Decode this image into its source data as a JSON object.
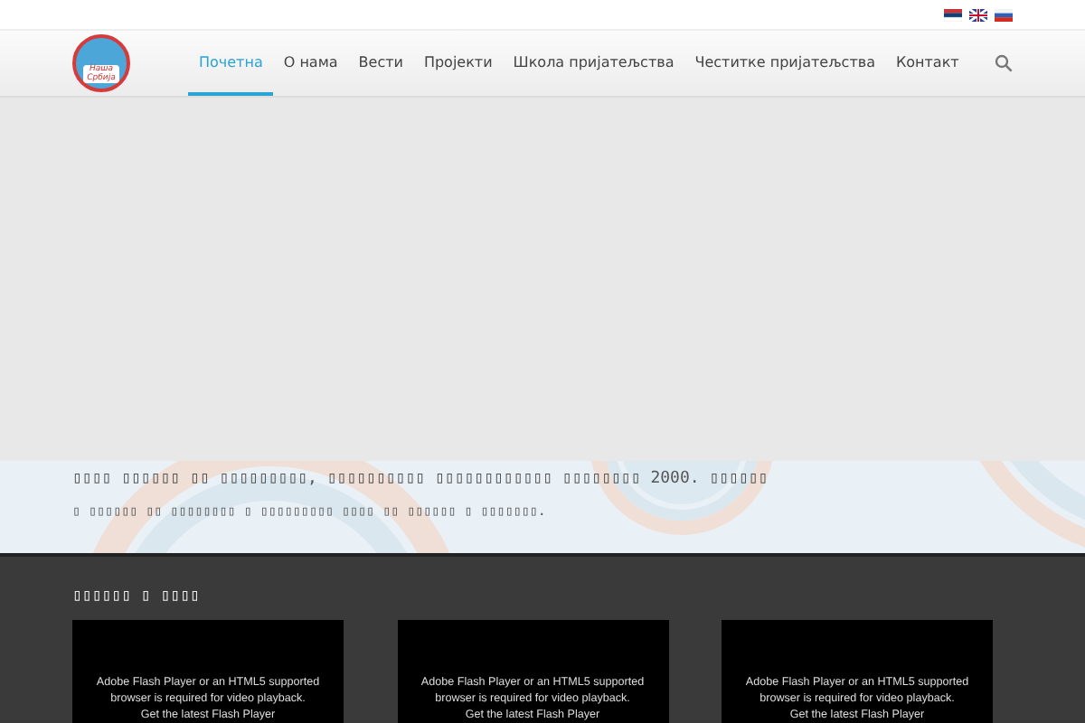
{
  "logo": {
    "text": "Наша Србија"
  },
  "nav": [
    {
      "label": "Почетна",
      "selected": true
    },
    {
      "label": "О нама",
      "selected": false
    },
    {
      "label": "Вести",
      "selected": false
    },
    {
      "label": "Пројекти",
      "selected": false
    },
    {
      "label": "Школа пријатељства",
      "selected": false
    },
    {
      "label": "Честитке пријатељства",
      "selected": false
    },
    {
      "label": "Контакт",
      "selected": false
    }
  ],
  "intro": [
    "▯▯▯▯ ▯▯▯▯▯▯ ▯▯ ▯▯▯▯▯▯▯▯▯, ▯▯▯▯▯▯▯▯▯▯ ▯▯▯▯▯▯▯▯▯▯▯▯ ▯▯▯▯▯▯▯▯ 2000. ▯▯▯▯▯▯",
    "▯ ▯▯▯▯▯▯ ▯▯ ▯▯▯▯▯▯▯▯ ▯ ▯▯▯▯▯▯▯▯▯ ▯▯▯▯ ▯▯ ▯▯▯▯▯▯ ▯ ▯▯▯▯▯▯▯."
  ],
  "videos_section": {
    "heading": "▯▯▯▯▯▯ ▯ ▯▯▯▯",
    "videos": [
      {
        "message": "Adobe Flash Player or an HTML5 supported browser is required for video playback.",
        "link": "Get the latest Flash Player"
      },
      {
        "message": "Adobe Flash Player or an HTML5 supported browser is required for video playback.",
        "link": "Get the latest Flash Player"
      },
      {
        "message": "Adobe Flash Player or an HTML5 supported browser is required for video playback.",
        "link": "Get the latest Flash Player"
      }
    ]
  }
}
